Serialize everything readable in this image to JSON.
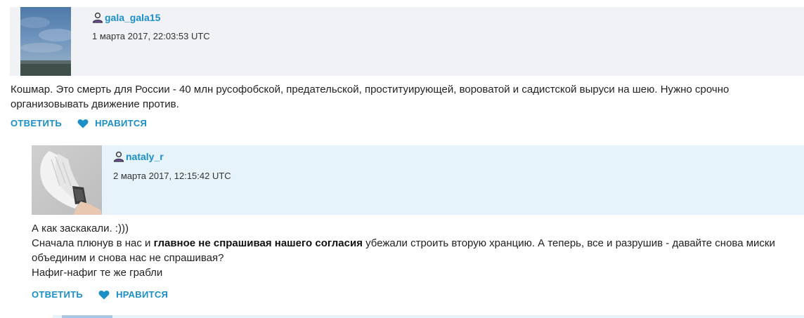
{
  "comments": [
    {
      "username": "gala_gala15",
      "timestamp": "1 марта 2017, 22:03:53 UTC",
      "body": [
        "Кошмар. Это смерть для России - 40 млн русофобской, предательской, проституирующей, вороватой и садистской выруси на шею. Нужно срочно организовывать движение против."
      ],
      "reply_label": "ОТВЕТИТЬ",
      "like_label": "НРАВИТСЯ"
    },
    {
      "username": "nataly_r",
      "timestamp": "2 марта 2017, 12:15:42 UTC",
      "body_line1": "А как заскакали. :)))",
      "body_line2_pre": "Сначала плюнув в нас и ",
      "body_line2_bold": "главное не спрашивая нашего согласия",
      "body_line2_post": " убежали строить вторую хранцию. А теперь, все и разрушив - давайте снова миски объединим и снова нас не спрашивая?",
      "body_line3": "Нафиг-нафиг те же грабли",
      "reply_label": "ОТВЕТИТЬ",
      "like_label": "НРАВИТСЯ"
    }
  ],
  "colors": {
    "accent": "#1b8fc7",
    "header_bg": "#f0f2f5",
    "reply_header_bg": "#e6f3fa"
  }
}
